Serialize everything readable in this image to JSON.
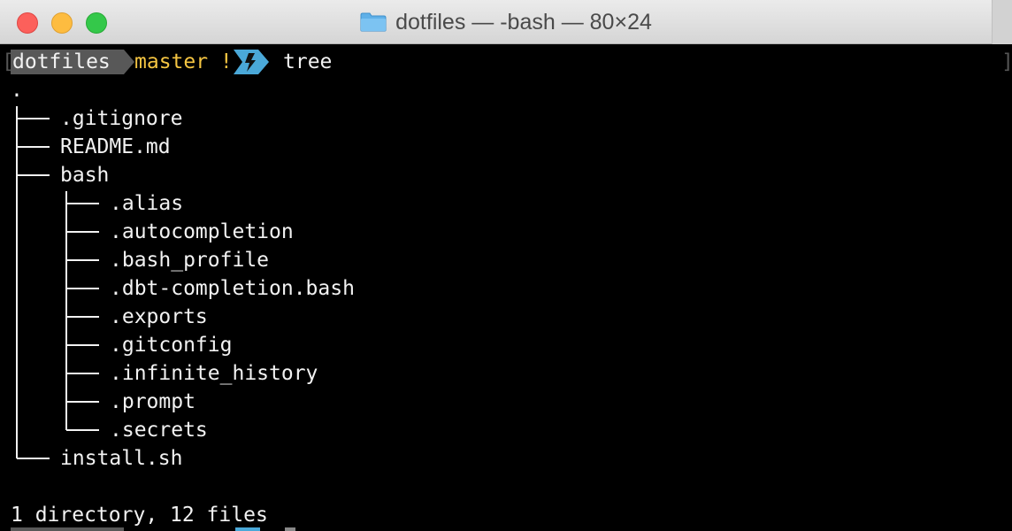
{
  "window": {
    "title": "dotfiles — -bash — 80×24"
  },
  "prompt": {
    "directory": "dotfiles",
    "branch": "master !",
    "command": "tree",
    "colors": {
      "dir_bg": "#585858",
      "branch": "#f5c542",
      "bolt_bg": "#4aa8d8"
    }
  },
  "output": {
    "root": ".",
    "entries": [
      {
        "label": ".gitignore"
      },
      {
        "label": "README.md"
      },
      {
        "label": "bash"
      },
      {
        "label": ".alias"
      },
      {
        "label": ".autocompletion"
      },
      {
        "label": ".bash_profile"
      },
      {
        "label": ".dbt-completion.bash"
      },
      {
        "label": ".exports"
      },
      {
        "label": ".gitconfig"
      },
      {
        "label": ".infinite_history"
      },
      {
        "label": ".prompt"
      },
      {
        "label": ".secrets"
      },
      {
        "label": "install.sh"
      }
    ],
    "summary": "1 directory, 12 files"
  }
}
